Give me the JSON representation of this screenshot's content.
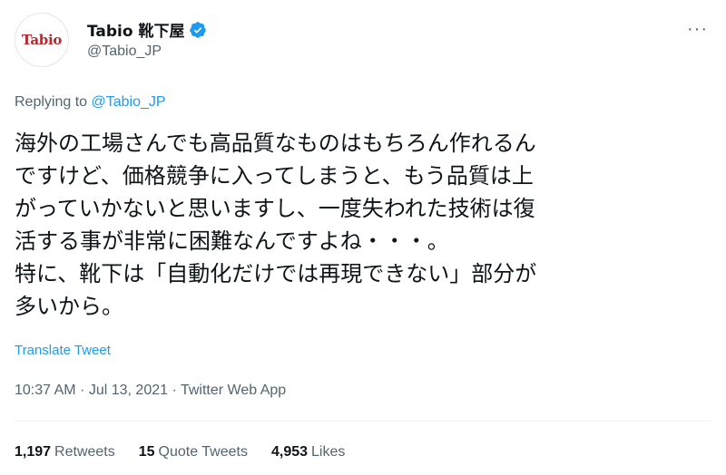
{
  "header": {
    "avatar_text": "Tabio",
    "display_name": "Tabio 靴下屋",
    "handle": "@Tabio_JP",
    "more_label": "···"
  },
  "reply": {
    "prefix": "Replying to",
    "mention": "@Tabio_JP"
  },
  "tweet": {
    "text": "海外の工場さんでも高品質なものはもちろん作れるん\nですけど、価格競争に入ってしまうと、もう品質は上\nがっていかないと思いますし、一度失われた技術は復\n活する事が非常に困難なんですよね・・・。\n特に、靴下は「自動化だけでは再現できない」部分が\n多いから。",
    "translate_label": "Translate Tweet"
  },
  "meta": {
    "time": "10:37 AM",
    "date": "Jul 13, 2021",
    "app": "Twitter Web App",
    "separator": " · "
  },
  "stats": {
    "retweets_count": "1,197",
    "retweets_label": "Retweets",
    "quotes_count": "15",
    "quotes_label": "Quote Tweets",
    "likes_count": "4,953",
    "likes_label": "Likes"
  },
  "colors": {
    "accent": "#1d9bf0",
    "secondary_text": "#536471",
    "brand_red": "#b4282e"
  }
}
